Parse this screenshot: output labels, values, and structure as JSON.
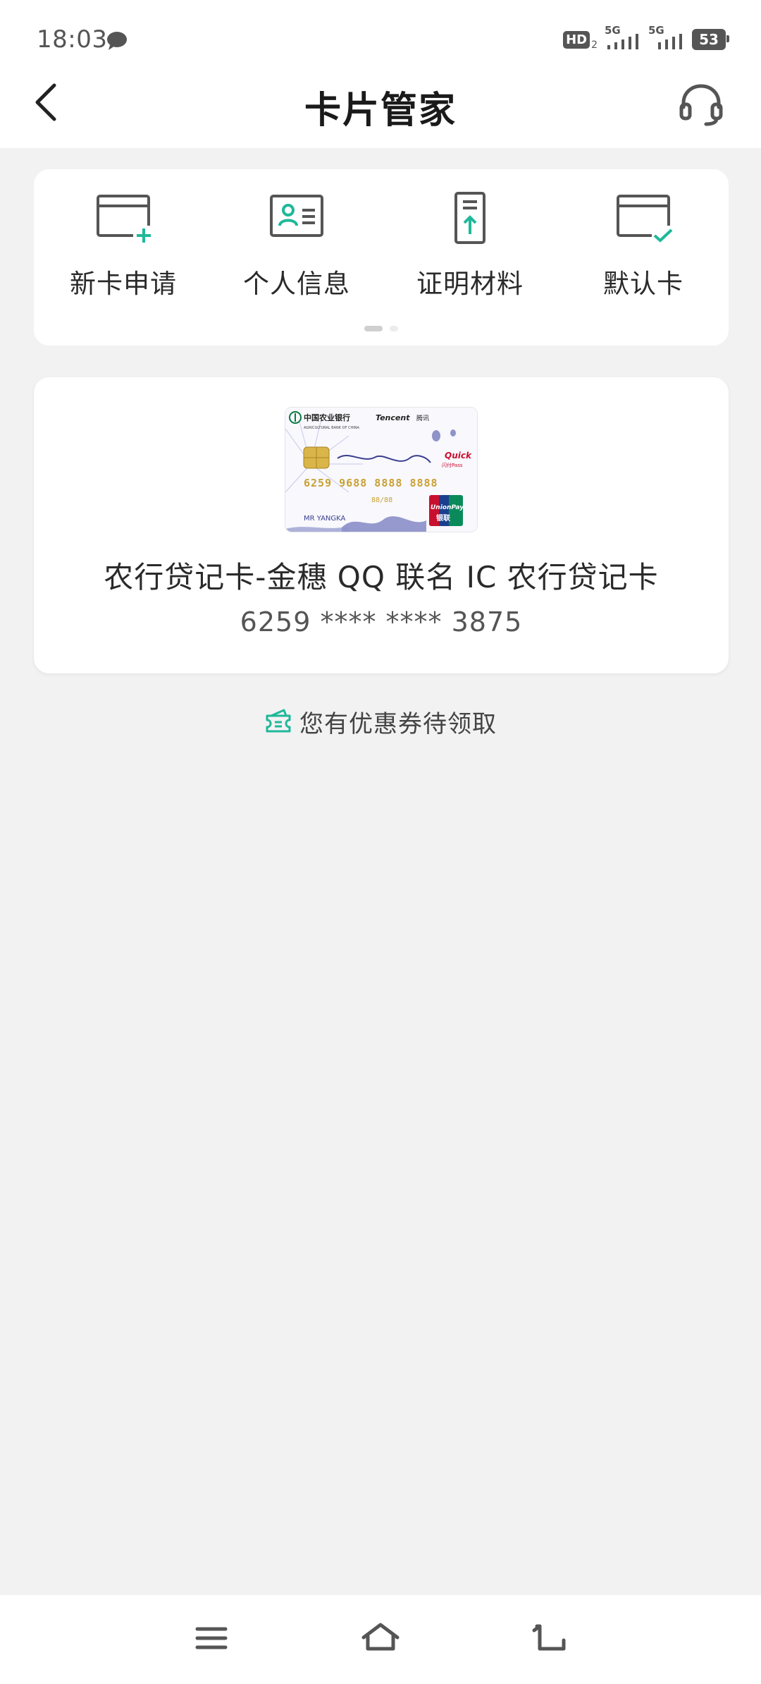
{
  "status_bar": {
    "time": "18:03",
    "hd_label": "HD",
    "hd_sub": "2",
    "signal1_label": "5G",
    "signal2_label": "5G",
    "battery": "53"
  },
  "header": {
    "title": "卡片管家"
  },
  "actions": [
    {
      "label": "新卡申请",
      "icon": "card-add-icon"
    },
    {
      "label": "个人信息",
      "icon": "id-card-icon"
    },
    {
      "label": "证明材料",
      "icon": "document-upload-icon"
    },
    {
      "label": "默认卡",
      "icon": "card-check-icon"
    }
  ],
  "pager": {
    "pages": 2,
    "active": 1
  },
  "card": {
    "name": "农行贷记卡-金穗 QQ 联名 IC 农行贷记卡",
    "number": "6259 **** **** 3875",
    "image": {
      "bank": "中国农业银行",
      "brand": "Tencent",
      "brand_cn": "腾讯",
      "sub": "AGRICULTURAL BANK OF CHINA",
      "number": "6259 9688 8888 8888",
      "expiry": "88/88",
      "holder": "MR YANGKA",
      "quickpass": "Quick",
      "quickpass_sub": "闪付Pass",
      "unionpay": "UnionPay",
      "unionpay_cn": "银联"
    }
  },
  "coupon": {
    "text": "您有优惠券待领取"
  },
  "colors": {
    "accent": "#1fb89a",
    "background": "#f2f2f3",
    "icon_gray": "#555555"
  }
}
